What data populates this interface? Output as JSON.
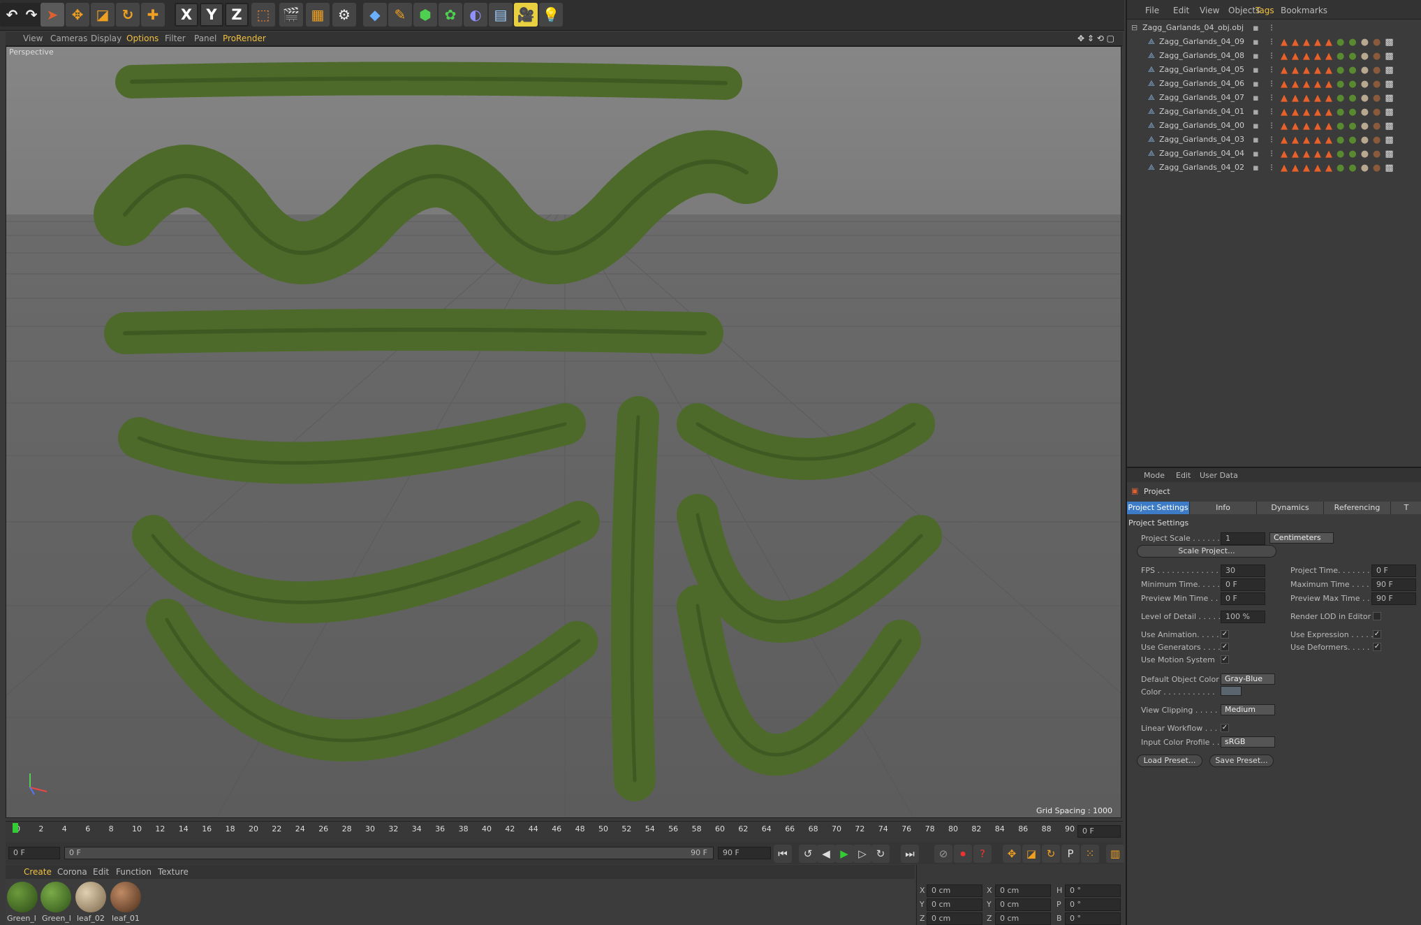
{
  "viewport_menu": [
    "View",
    "Cameras",
    "Display",
    "Options",
    "Filter",
    "Panel",
    "ProRender"
  ],
  "viewport": {
    "label": "Perspective",
    "grid_spacing": "Grid Spacing : 1000 cm"
  },
  "toolbar": {
    "x": "X",
    "y": "Y",
    "z": "Z"
  },
  "timeline": {
    "ticks": [
      "0",
      "2",
      "4",
      "6",
      "8",
      "10",
      "12",
      "14",
      "16",
      "18",
      "20",
      "22",
      "24",
      "26",
      "28",
      "30",
      "32",
      "34",
      "36",
      "38",
      "40",
      "42",
      "44",
      "46",
      "48",
      "50",
      "52",
      "54",
      "56",
      "58",
      "60",
      "62",
      "64",
      "66",
      "68",
      "70",
      "72",
      "74",
      "76",
      "78",
      "80",
      "82",
      "84",
      "86",
      "88",
      "90"
    ],
    "frame_field": "0 F"
  },
  "transport": {
    "start": "0 F",
    "range_start": "0 F",
    "range_end": "90 F",
    "end": "90 F"
  },
  "material_menu": [
    "Create",
    "Corona",
    "Edit",
    "Function",
    "Texture"
  ],
  "materials": [
    {
      "label": "Green_l",
      "color": "#3d6b24"
    },
    {
      "label": "Green_l",
      "color": "#4b7a2c"
    },
    {
      "label": "leaf_02",
      "color": "#b9a383"
    },
    {
      "label": "leaf_01",
      "color": "#8a5a3b"
    }
  ],
  "coords": {
    "rows": [
      {
        "a": "X",
        "av": "0 cm",
        "b": "X",
        "bv": "0 cm",
        "c": "H",
        "cv": "0 °"
      },
      {
        "a": "Y",
        "av": "0 cm",
        "b": "Y",
        "bv": "0 cm",
        "c": "P",
        "cv": "0 °"
      },
      {
        "a": "Z",
        "av": "0 cm",
        "b": "Z",
        "bv": "0 cm",
        "c": "B",
        "cv": "0 °"
      }
    ]
  },
  "object_menu": [
    "File",
    "Edit",
    "View",
    "Objects",
    "Tags",
    "Bookmarks"
  ],
  "objects": {
    "root": "Zagg_Garlands_04_obj.obj",
    "children": [
      "Zagg_Garlands_04_09",
      "Zagg_Garlands_04_08",
      "Zagg_Garlands_04_05",
      "Zagg_Garlands_04_06",
      "Zagg_Garlands_04_07",
      "Zagg_Garlands_04_01",
      "Zagg_Garlands_04_00",
      "Zagg_Garlands_04_03",
      "Zagg_Garlands_04_04",
      "Zagg_Garlands_04_02"
    ]
  },
  "attr_menu": [
    "Mode",
    "Edit",
    "User Data"
  ],
  "attr": {
    "object_label": "Project",
    "tabs": [
      "Project Settings",
      "Info",
      "Dynamics",
      "Referencing",
      "T"
    ],
    "section": "Project Settings",
    "project_scale_label": "Project Scale . . . . . .",
    "project_scale_value": "1",
    "project_scale_unit": "Centimeters",
    "scale_button": "Scale Project...",
    "fps_label": "FPS . . . . . . . . . . . . . . .",
    "fps_value": "30",
    "project_time_label": "Project Time. . . . . . . . .",
    "project_time_value": "0 F",
    "min_time_label": "Minimum Time. . . . . . .",
    "min_time_value": "0 F",
    "max_time_label": "Maximum Time . . . . . .",
    "max_time_value": "90 F",
    "prev_min_label": "Preview Min Time . . .",
    "prev_min_value": "0 F",
    "prev_max_label": "Preview Max Time . . .",
    "prev_max_value": "90 F",
    "lod_label": "Level of Detail . . . . . .",
    "lod_value": "100 %",
    "render_lod_label": "Render LOD in Editor",
    "use_anim_label": "Use Animation. . . . . .",
    "use_expr_label": "Use Expression . . . . .",
    "use_gen_label": "Use Generators . . . . .",
    "use_def_label": "Use Deformers. . . . . .",
    "use_motion_label": "Use Motion System",
    "default_color_label": "Default Object Color",
    "default_color_value": "Gray-Blue",
    "color_label": "Color . . . . . . . . . . .",
    "view_clip_label": "View Clipping . . . . . .",
    "view_clip_value": "Medium",
    "linear_label": "Linear Workflow . . . .",
    "input_profile_label": "Input Color Profile . .",
    "input_profile_value": "sRGB",
    "load_preset": "Load Preset...",
    "save_preset": "Save Preset...",
    "check": "✓"
  }
}
